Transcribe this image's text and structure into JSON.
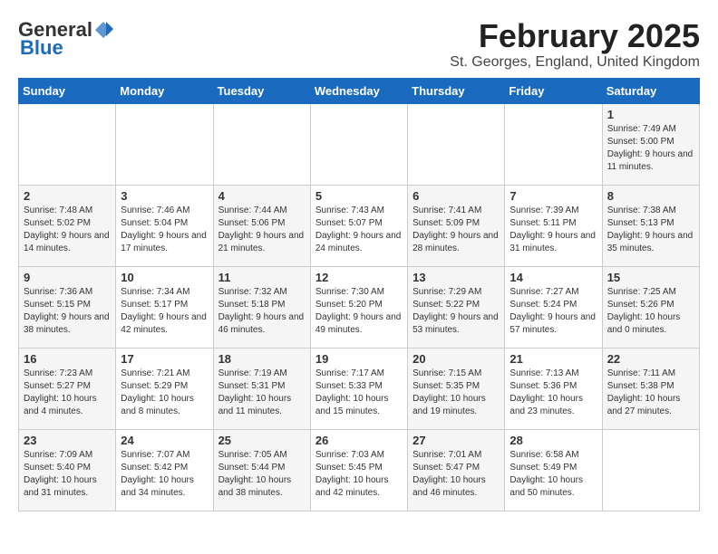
{
  "header": {
    "logo_general": "General",
    "logo_blue": "Blue",
    "month_title": "February 2025",
    "location": "St. Georges, England, United Kingdom"
  },
  "weekdays": [
    "Sunday",
    "Monday",
    "Tuesday",
    "Wednesday",
    "Thursday",
    "Friday",
    "Saturday"
  ],
  "weeks": [
    [
      {
        "day": "",
        "info": ""
      },
      {
        "day": "",
        "info": ""
      },
      {
        "day": "",
        "info": ""
      },
      {
        "day": "",
        "info": ""
      },
      {
        "day": "",
        "info": ""
      },
      {
        "day": "",
        "info": ""
      },
      {
        "day": "1",
        "info": "Sunrise: 7:49 AM\nSunset: 5:00 PM\nDaylight: 9 hours and 11 minutes."
      }
    ],
    [
      {
        "day": "2",
        "info": "Sunrise: 7:48 AM\nSunset: 5:02 PM\nDaylight: 9 hours and 14 minutes."
      },
      {
        "day": "3",
        "info": "Sunrise: 7:46 AM\nSunset: 5:04 PM\nDaylight: 9 hours and 17 minutes."
      },
      {
        "day": "4",
        "info": "Sunrise: 7:44 AM\nSunset: 5:06 PM\nDaylight: 9 hours and 21 minutes."
      },
      {
        "day": "5",
        "info": "Sunrise: 7:43 AM\nSunset: 5:07 PM\nDaylight: 9 hours and 24 minutes."
      },
      {
        "day": "6",
        "info": "Sunrise: 7:41 AM\nSunset: 5:09 PM\nDaylight: 9 hours and 28 minutes."
      },
      {
        "day": "7",
        "info": "Sunrise: 7:39 AM\nSunset: 5:11 PM\nDaylight: 9 hours and 31 minutes."
      },
      {
        "day": "8",
        "info": "Sunrise: 7:38 AM\nSunset: 5:13 PM\nDaylight: 9 hours and 35 minutes."
      }
    ],
    [
      {
        "day": "9",
        "info": "Sunrise: 7:36 AM\nSunset: 5:15 PM\nDaylight: 9 hours and 38 minutes."
      },
      {
        "day": "10",
        "info": "Sunrise: 7:34 AM\nSunset: 5:17 PM\nDaylight: 9 hours and 42 minutes."
      },
      {
        "day": "11",
        "info": "Sunrise: 7:32 AM\nSunset: 5:18 PM\nDaylight: 9 hours and 46 minutes."
      },
      {
        "day": "12",
        "info": "Sunrise: 7:30 AM\nSunset: 5:20 PM\nDaylight: 9 hours and 49 minutes."
      },
      {
        "day": "13",
        "info": "Sunrise: 7:29 AM\nSunset: 5:22 PM\nDaylight: 9 hours and 53 minutes."
      },
      {
        "day": "14",
        "info": "Sunrise: 7:27 AM\nSunset: 5:24 PM\nDaylight: 9 hours and 57 minutes."
      },
      {
        "day": "15",
        "info": "Sunrise: 7:25 AM\nSunset: 5:26 PM\nDaylight: 10 hours and 0 minutes."
      }
    ],
    [
      {
        "day": "16",
        "info": "Sunrise: 7:23 AM\nSunset: 5:27 PM\nDaylight: 10 hours and 4 minutes."
      },
      {
        "day": "17",
        "info": "Sunrise: 7:21 AM\nSunset: 5:29 PM\nDaylight: 10 hours and 8 minutes."
      },
      {
        "day": "18",
        "info": "Sunrise: 7:19 AM\nSunset: 5:31 PM\nDaylight: 10 hours and 11 minutes."
      },
      {
        "day": "19",
        "info": "Sunrise: 7:17 AM\nSunset: 5:33 PM\nDaylight: 10 hours and 15 minutes."
      },
      {
        "day": "20",
        "info": "Sunrise: 7:15 AM\nSunset: 5:35 PM\nDaylight: 10 hours and 19 minutes."
      },
      {
        "day": "21",
        "info": "Sunrise: 7:13 AM\nSunset: 5:36 PM\nDaylight: 10 hours and 23 minutes."
      },
      {
        "day": "22",
        "info": "Sunrise: 7:11 AM\nSunset: 5:38 PM\nDaylight: 10 hours and 27 minutes."
      }
    ],
    [
      {
        "day": "23",
        "info": "Sunrise: 7:09 AM\nSunset: 5:40 PM\nDaylight: 10 hours and 31 minutes."
      },
      {
        "day": "24",
        "info": "Sunrise: 7:07 AM\nSunset: 5:42 PM\nDaylight: 10 hours and 34 minutes."
      },
      {
        "day": "25",
        "info": "Sunrise: 7:05 AM\nSunset: 5:44 PM\nDaylight: 10 hours and 38 minutes."
      },
      {
        "day": "26",
        "info": "Sunrise: 7:03 AM\nSunset: 5:45 PM\nDaylight: 10 hours and 42 minutes."
      },
      {
        "day": "27",
        "info": "Sunrise: 7:01 AM\nSunset: 5:47 PM\nDaylight: 10 hours and 46 minutes."
      },
      {
        "day": "28",
        "info": "Sunrise: 6:58 AM\nSunset: 5:49 PM\nDaylight: 10 hours and 50 minutes."
      },
      {
        "day": "",
        "info": ""
      }
    ]
  ]
}
